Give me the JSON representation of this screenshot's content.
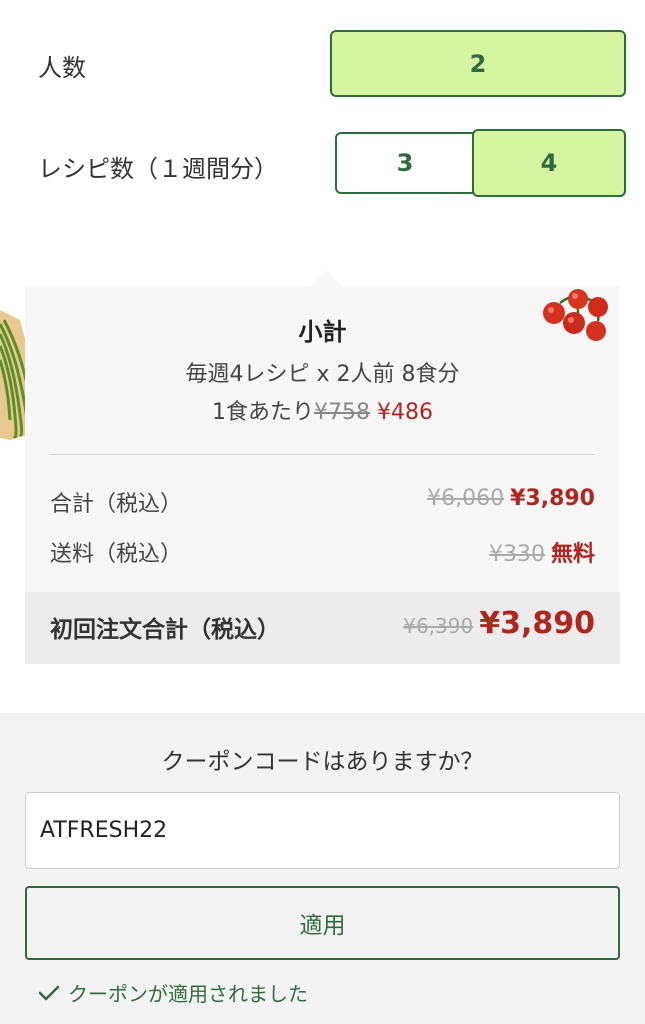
{
  "people": {
    "label": "人数",
    "options": [
      "2"
    ],
    "selected": "2"
  },
  "recipes": {
    "label": "レシピ数（１週間分）",
    "options": [
      "3",
      "4"
    ],
    "selected": "4"
  },
  "summary": {
    "title": "小計",
    "description": "毎週4レシピ x 2人前 8食分",
    "per_meal_label": "1食あたり",
    "per_meal_original": "¥758",
    "per_meal_price": "¥486",
    "lines": [
      {
        "label": "合計（税込）",
        "original": "¥6,060",
        "price": "¥3,890"
      },
      {
        "label": "送料（税込）",
        "original": "¥330",
        "price": "無料"
      }
    ],
    "total": {
      "label": "初回注文合計（税込）",
      "original": "¥6,390",
      "price": "¥3,890"
    }
  },
  "coupon": {
    "question": "クーポンコードはありますか？",
    "code_value": "ATFRESH22",
    "apply_label": "適用",
    "applied_message": "クーポンが適用されました"
  },
  "colors": {
    "accent_green": "#2f6b3f",
    "selected_fill": "#d6f5a0",
    "price_red": "#b0261e"
  },
  "icons": {
    "applied": "check-icon"
  }
}
